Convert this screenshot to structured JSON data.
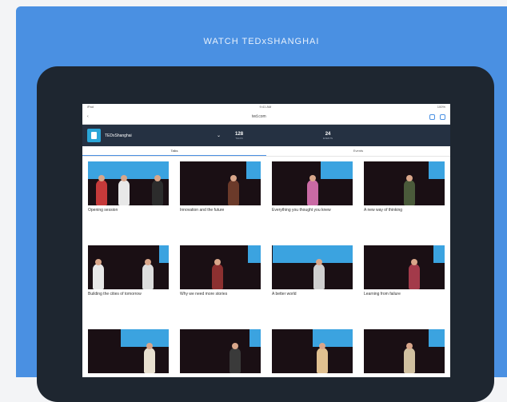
{
  "banner": {
    "title": "WATCH TEDxSHANGHAI",
    "bg_color": "#4a90e2"
  },
  "screen": {
    "status": {
      "left": "iPad",
      "center": "9:41 AM",
      "right": "100%"
    },
    "url": "ted.com",
    "app": {
      "name": "TEDxShanghai",
      "stats": [
        {
          "num": "128",
          "label": "TALKS"
        },
        {
          "num": "24",
          "label": "EVENTS"
        }
      ]
    },
    "tabs": [
      {
        "label": "Talks",
        "active": true
      },
      {
        "label": "Events",
        "active": false
      }
    ],
    "cards": [
      {
        "title": "Opening session",
        "meta": ""
      },
      {
        "title": "Innovation and the future",
        "meta": ""
      },
      {
        "title": "Everything you thought you knew",
        "meta": ""
      },
      {
        "title": "A new way of thinking",
        "meta": ""
      },
      {
        "title": "Building the cities of tomorrow",
        "meta": ""
      },
      {
        "title": "Why we need more stories",
        "meta": ""
      },
      {
        "title": "A better world",
        "meta": ""
      },
      {
        "title": "Learning from failure",
        "meta": ""
      },
      {
        "title": "",
        "meta": ""
      },
      {
        "title": "",
        "meta": ""
      },
      {
        "title": "",
        "meta": ""
      },
      {
        "title": "",
        "meta": ""
      }
    ]
  }
}
